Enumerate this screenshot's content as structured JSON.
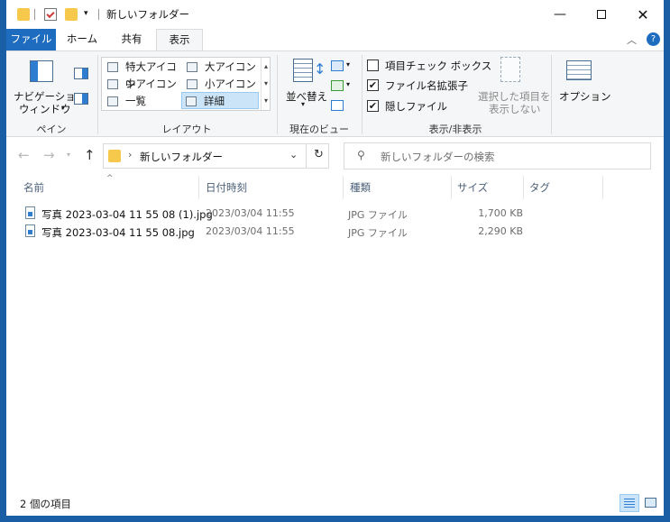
{
  "window": {
    "title": "新しいフォルダー"
  },
  "ribbon_tabs": [
    {
      "label": "ファイル"
    },
    {
      "label": "ホーム"
    },
    {
      "label": "共有"
    },
    {
      "label": "表示"
    }
  ],
  "ribbon": {
    "pane": {
      "nav_pane_label_1": "ナビゲーション",
      "nav_pane_label_2": "ウィンドウ",
      "group": "ペイン"
    },
    "layout": {
      "items": [
        {
          "label": "特大アイコン"
        },
        {
          "label": "大アイコン"
        },
        {
          "label": "中アイコン"
        },
        {
          "label": "小アイコン"
        },
        {
          "label": "一覧"
        },
        {
          "label": "詳細"
        }
      ],
      "selected": "詳細",
      "group": "レイアウト"
    },
    "current_view": {
      "sort_label": "並べ替え",
      "group": "現在のビュー"
    },
    "show_hide": {
      "checkboxes": [
        {
          "label": "項目チェック ボックス",
          "checked": false
        },
        {
          "label": "ファイル名拡張子",
          "checked": true
        },
        {
          "label": "隠しファイル",
          "checked": true
        }
      ],
      "hide_selected_1": "選択した項目を",
      "hide_selected_2": "表示しない",
      "group": "表示/非表示"
    },
    "options_label": "オプション"
  },
  "address": {
    "path": "新しいフォルダー"
  },
  "search": {
    "placeholder": "新しいフォルダーの検索"
  },
  "columns": [
    {
      "label": "名前"
    },
    {
      "label": "日付時刻"
    },
    {
      "label": "種類"
    },
    {
      "label": "サイズ"
    },
    {
      "label": "タグ"
    }
  ],
  "files": [
    {
      "name": "写真 2023-03-04 11 55 08 (1).jpg",
      "date": "2023/03/04 11:55",
      "type": "JPG ファイル",
      "size": "1,700 KB"
    },
    {
      "name": "写真 2023-03-04 11 55 08.jpg",
      "date": "2023/03/04 11:55",
      "type": "JPG ファイル",
      "size": "2,290 KB"
    }
  ],
  "status": {
    "count_text": "2 個の項目"
  },
  "colors": {
    "accent": "#1e6cc0",
    "frame": "#1a5fa6",
    "folder": "#f6c94c"
  }
}
